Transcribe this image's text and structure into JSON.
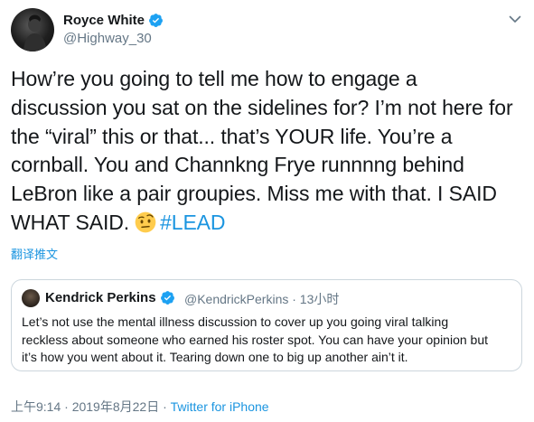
{
  "author": {
    "name": "Royce White",
    "handle": "@Highway_30"
  },
  "tweet": {
    "lines": [
      "How’re you going to tell me how to engage a",
      "discussion you sat on the sidelines for? I’m not here for",
      "the “viral” this or that... that’s YOUR life. You’re a",
      "cornball. You and Channkng Frye runnnng behind",
      "LeBron like a pair groupies. Miss me with that. I SAID",
      "WHAT SAID."
    ],
    "emoji": "face-with-raised-eyebrow",
    "hashtag": "#LEAD"
  },
  "translate_label": "翻译推文",
  "quoted": {
    "name": "Kendrick Perkins",
    "handle_time": "@KendrickPerkins · 13小时",
    "lines": [
      "Let’s not use the  mental illness discussion to cover up you going viral talking",
      "reckless about someone who earned his roster spot. You can have your opinion but",
      "it’s how you went about it. Tearing down one to big up another ain’t it."
    ]
  },
  "meta": {
    "time_date": "上午9:14 · 2019年8月22日 · ",
    "source": "Twitter for iPhone"
  },
  "colors": {
    "link": "#1b95e0",
    "secondary_text": "#657786",
    "verified": "#1da1f2",
    "border": "#ccd6dd"
  }
}
